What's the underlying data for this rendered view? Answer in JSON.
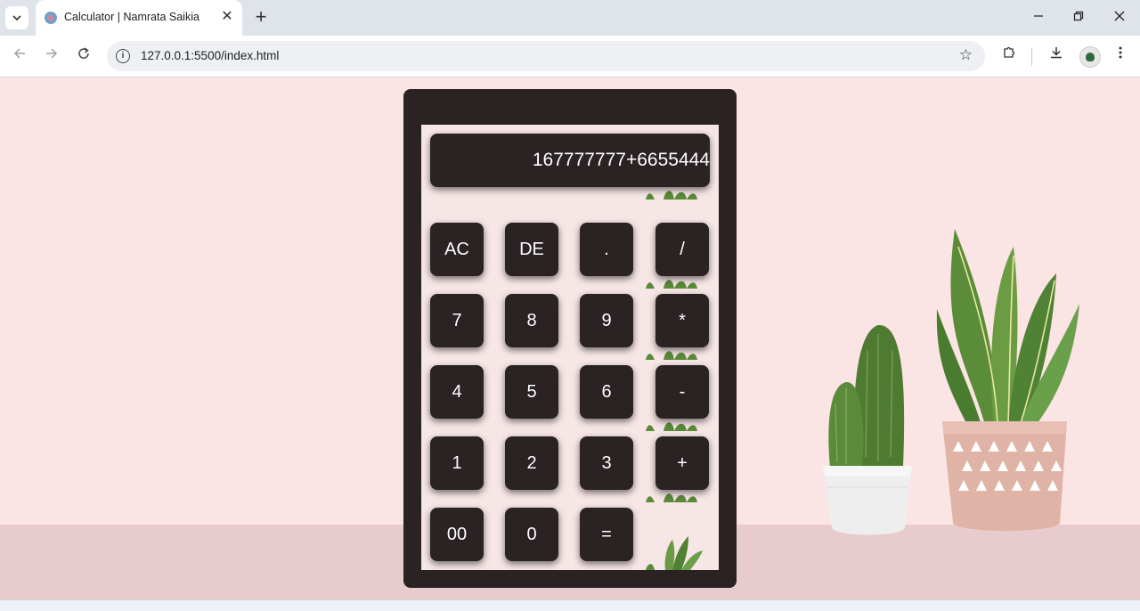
{
  "browser": {
    "tab": {
      "title": "Calculator | Namrata Saikia",
      "close_glyph": "✕"
    },
    "new_tab_glyph": "+",
    "url": "127.0.0.1:5500/index.html",
    "window_controls": {
      "minimize": "—",
      "restore": "❐",
      "close": "✕"
    }
  },
  "calculator": {
    "display": "167777777+6655444",
    "keys": [
      {
        "id": "ac",
        "label": "AC"
      },
      {
        "id": "de",
        "label": "DE"
      },
      {
        "id": "dot",
        "label": "."
      },
      {
        "id": "divide",
        "label": "/"
      },
      {
        "id": "7",
        "label": "7"
      },
      {
        "id": "8",
        "label": "8"
      },
      {
        "id": "9",
        "label": "9"
      },
      {
        "id": "multiply",
        "label": "*"
      },
      {
        "id": "4",
        "label": "4"
      },
      {
        "id": "5",
        "label": "5"
      },
      {
        "id": "6",
        "label": "6"
      },
      {
        "id": "minus",
        "label": "-"
      },
      {
        "id": "1",
        "label": "1"
      },
      {
        "id": "2",
        "label": "2"
      },
      {
        "id": "3",
        "label": "3"
      },
      {
        "id": "plus",
        "label": "+"
      },
      {
        "id": "00",
        "label": "00"
      },
      {
        "id": "0",
        "label": "0"
      },
      {
        "id": "equals",
        "label": "="
      }
    ]
  },
  "colors": {
    "calculator_body": "#2a2223",
    "page_background": "#fbe4e4",
    "key_text": "#ffffff"
  }
}
